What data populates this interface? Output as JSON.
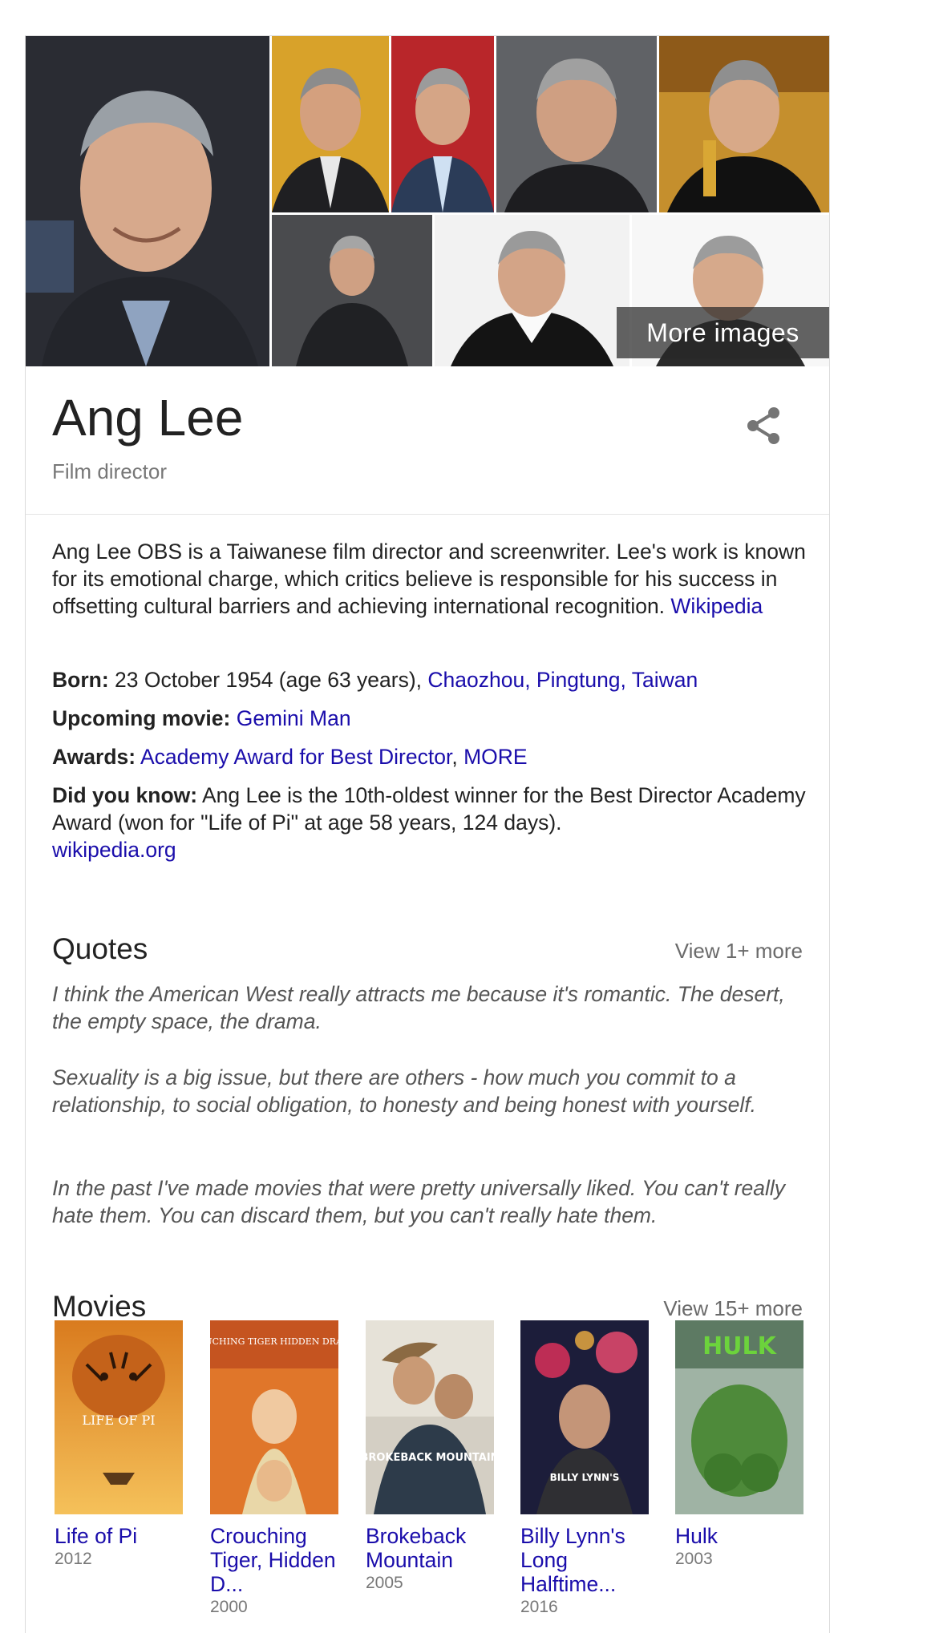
{
  "images": {
    "more_label": "More images"
  },
  "header": {
    "title": "Ang Lee",
    "subtitle": "Film director"
  },
  "description": {
    "text": "Ang Lee OBS is a Taiwanese film director and screenwriter. Lee's work is known for its emotional charge, which critics believe is responsible for his success in offsetting cultural barriers and achieving international recognition. ",
    "source": "Wikipedia"
  },
  "facts": {
    "born_label": "Born:",
    "born_value": " 23 October 1954 (age 63 years), ",
    "born_place": "Chaozhou, Pingtung, Taiwan",
    "upcoming_label": "Upcoming movie:",
    "upcoming_value": "Gemini Man",
    "awards_label": "Awards:",
    "awards_value": "Academy Award for Best Director",
    "awards_sep": ", ",
    "awards_more": "MORE",
    "dyk_label": "Did you know:",
    "dyk_value": " Ang Lee is the 10th-oldest winner for the Best Director Academy Award (won for \"Life of Pi\" at age 58 years, 124 days).",
    "dyk_source": "wikipedia.org"
  },
  "quotes": {
    "title": "Quotes",
    "more": "View 1+ more",
    "items": [
      "I think the American West really attracts me because it's romantic. The desert, the empty space, the drama.",
      "Sexuality is a big issue, but there are others - how much you commit to a relationship, to social obligation, to honesty and being honest with yourself.",
      "In the past I've made movies that were pretty universally liked. You can't really hate them. You can discard them, but you can't really hate them."
    ]
  },
  "movies": {
    "title": "Movies",
    "more": "View 15+ more",
    "items": [
      {
        "title": "Life of Pi",
        "year": "2012",
        "poster_text": "LIFE OF PI"
      },
      {
        "title": "Crouching Tiger, Hidden D...",
        "year": "2000",
        "poster_text": "CROUCHING TIGER HIDDEN DRAGON"
      },
      {
        "title": "Brokeback Mountain",
        "year": "2005",
        "poster_text": "BROKEBACK MOUNTAIN"
      },
      {
        "title": "Billy Lynn's Long Halftime...",
        "year": "2016",
        "poster_text": "BILLY LYNN'S"
      },
      {
        "title": "Hulk",
        "year": "2003",
        "poster_text": "HULK"
      }
    ]
  },
  "icons": {
    "share": "share-icon"
  }
}
